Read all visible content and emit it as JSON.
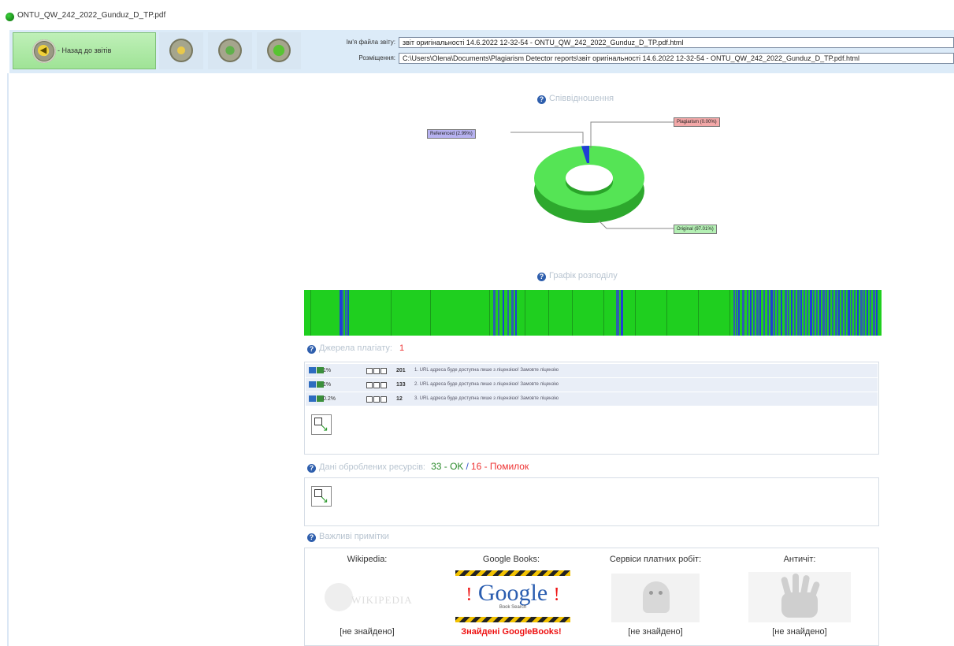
{
  "window": {
    "title": "ONTU_QW_242_2022_Gunduz_D_TP.pdf"
  },
  "toolbar": {
    "back_label": "- Назад до звітів",
    "file_name_label": "Ім'я файла звіту:",
    "file_name_value": "звіт оригінальності 14.6.2022 12-32-54 - ONTU_QW_242_2022_Gunduz_D_TP.pdf.html",
    "location_label": "Розміщення:",
    "location_value": "C:\\Users\\Olena\\Documents\\Plagiarism Detector reports\\звіт оригінальності 14.6.2022 12-32-54 - ONTU_QW_242_2022_Gunduz_D_TP.pdf.html"
  },
  "ratio": {
    "heading": "Співвідношення",
    "referenced_label": "Referenced (2.99%)",
    "plagiarism_label": "Plagiarism (0.00%)",
    "original_label": "Original (97.01%)",
    "colors": {
      "original": "#4ee04e",
      "referenced": "#1f3fd6",
      "plagiarism": "#e06060"
    }
  },
  "chart_data": {
    "type": "pie",
    "labels": [
      "Original",
      "Referenced",
      "Plagiarism"
    ],
    "values": [
      97.01,
      2.99,
      0.0
    ]
  },
  "distribution": {
    "heading": "Графік розподілу"
  },
  "sources": {
    "heading": "Джерела плагіату:",
    "count": "1",
    "rows": [
      {
        "pct": "1%",
        "num": "201",
        "url": "1. URL адреса буде доступна лише з ліцензією! Замовте ліцензію"
      },
      {
        "pct": "1%",
        "num": "133",
        "url": "2. URL адреса буде доступна лише з ліцензією! Замовте ліцензію"
      },
      {
        "pct": "0.2%",
        "num": "12",
        "url": "3. URL адреса буде доступна лише з ліцензією! Замовте ліцензію"
      }
    ]
  },
  "processed": {
    "heading": "Дані оброблених ресурсів:",
    "ok_text": "33 - OK",
    "separator": "/",
    "err_text": "16 - Помилок"
  },
  "notes": {
    "heading": "Важливі примітки",
    "wikipedia": {
      "label": "Wikipedia:",
      "status": "[не знайдено]"
    },
    "google_books": {
      "label": "Google Books:",
      "status": "Знайдені GoogleBooks!",
      "logo_text": "Google",
      "logo_sub": "Book Search"
    },
    "paid": {
      "label": "Сервіси платних робіт:",
      "status": "[не знайдено]"
    },
    "anticheat": {
      "label": "Античіт:",
      "status": "[не знайдено]"
    }
  }
}
